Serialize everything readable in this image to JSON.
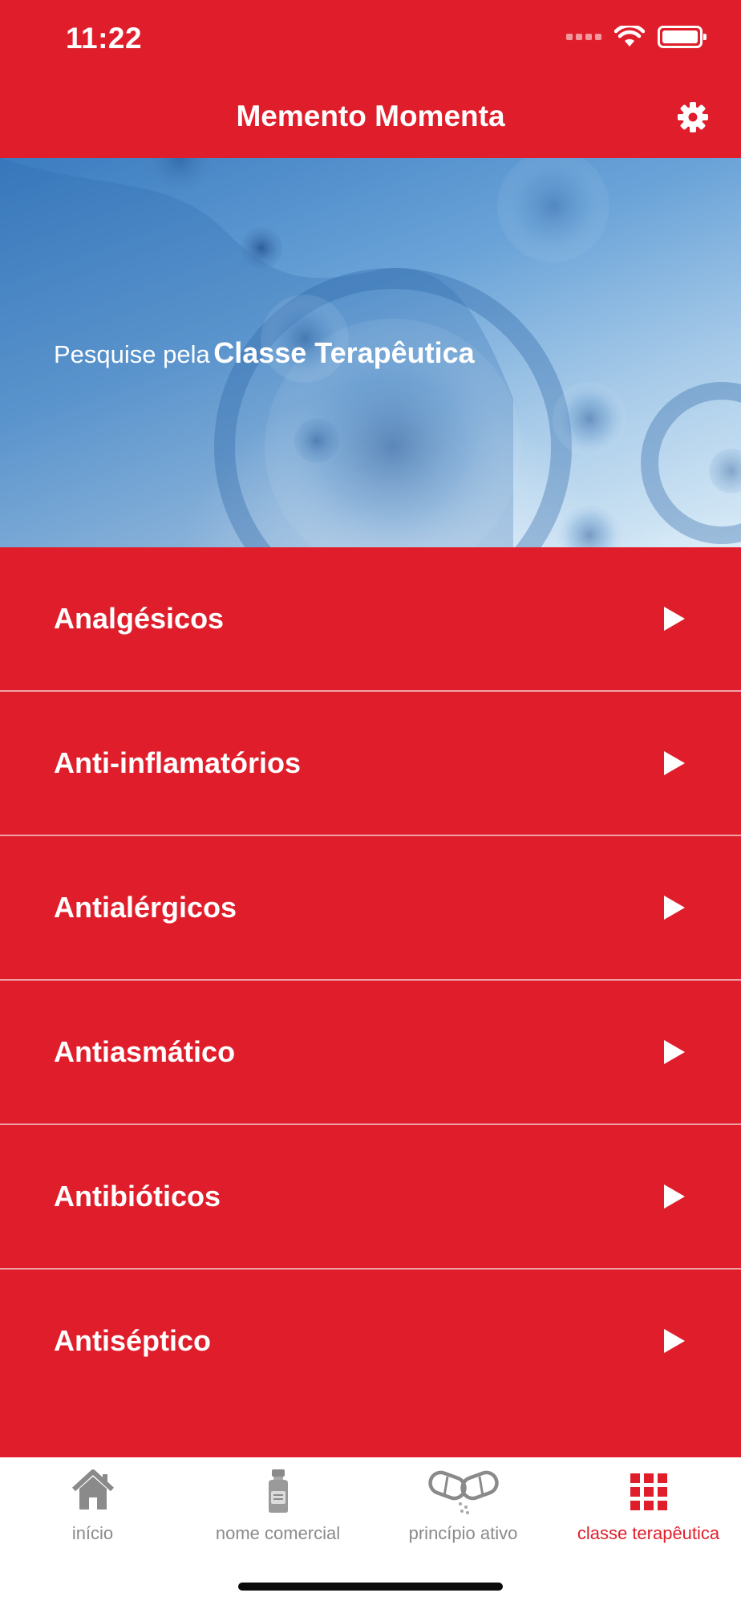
{
  "status_bar": {
    "time": "11:22"
  },
  "header": {
    "title": "Memento Momenta",
    "settings_icon": "gear-icon"
  },
  "hero": {
    "prefix": "Pesquise pela",
    "highlight": "Classe Terapêutica"
  },
  "list": {
    "items": [
      {
        "label": "Analgésicos"
      },
      {
        "label": "Anti-inflamatórios"
      },
      {
        "label": "Antialérgicos"
      },
      {
        "label": "Antiasmático"
      },
      {
        "label": "Antibióticos"
      },
      {
        "label": "Antiséptico"
      }
    ]
  },
  "tabbar": {
    "tabs": [
      {
        "label": "início",
        "icon": "home-icon",
        "active": false
      },
      {
        "label": "nome comercial",
        "icon": "medicine-bottle-icon",
        "active": false
      },
      {
        "label": "princípio ativo",
        "icon": "capsule-icon",
        "active": false
      },
      {
        "label": "classe terapêutica",
        "icon": "grid-icon",
        "active": true
      }
    ]
  },
  "colors": {
    "brand_red": "#e01e2b",
    "inactive_gray": "#8a8a8a"
  }
}
